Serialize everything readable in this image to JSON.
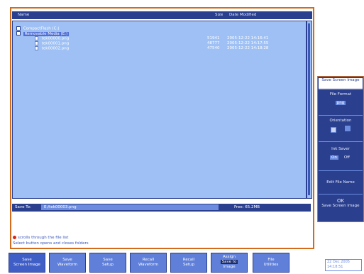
{
  "file_list": {
    "columns": {
      "name": "Name",
      "size": "Size",
      "date": "Date Modified"
    },
    "tree": [
      {
        "label": "CompactFlash (C:)"
      },
      {
        "label": "Removable Media (E:)"
      }
    ],
    "files": [
      {
        "name": "tek00000.png",
        "size": "51941",
        "date": "2005-12-22 14:16:41"
      },
      {
        "name": "tek00001.png",
        "size": "48777",
        "date": "2005-12-22 14:17:55"
      },
      {
        "name": "tek00002.png",
        "size": "47540",
        "date": "2005-12-22 14:18:28"
      }
    ]
  },
  "save_to": {
    "label": "Save To:",
    "value": "E:/tek00003.png",
    "free": "Free: 65.2MB"
  },
  "hints": {
    "line1": "scrolls through the file list",
    "line2": "Select button opens and closes folders"
  },
  "side_menu": {
    "title": "Save Screen Image",
    "file_format": {
      "label": "File Format",
      "value": "png"
    },
    "orientation": {
      "label": "Orientation"
    },
    "ink_saver": {
      "label": "Ink Saver",
      "on": "On",
      "off": "Off"
    },
    "edit_file_name": {
      "label": "Edit File Name"
    },
    "ok": {
      "label": "OK",
      "sub": "Save Screen Image"
    }
  },
  "softkeys": [
    {
      "l1": "Save",
      "l2": "Screen Image"
    },
    {
      "l1": "Save",
      "l2": "Waveform"
    },
    {
      "l1": "Save",
      "l2": "Setup"
    },
    {
      "l1": "Recall",
      "l2": "Waveform"
    },
    {
      "l1": "Recall",
      "l2": "Setup"
    },
    {
      "l1": "Assign",
      "l2": "Save to",
      "l3": "Image"
    },
    {
      "l1": "File",
      "l2": "Utilities"
    }
  ],
  "clock": {
    "date": "22 Dec 2005",
    "time": "14:18:51"
  },
  "colors": {
    "accent_border": "#d36c1a",
    "panel": "#2a3f8e",
    "list_bg": "#9ec0f4",
    "button": "#5f7fd9"
  }
}
